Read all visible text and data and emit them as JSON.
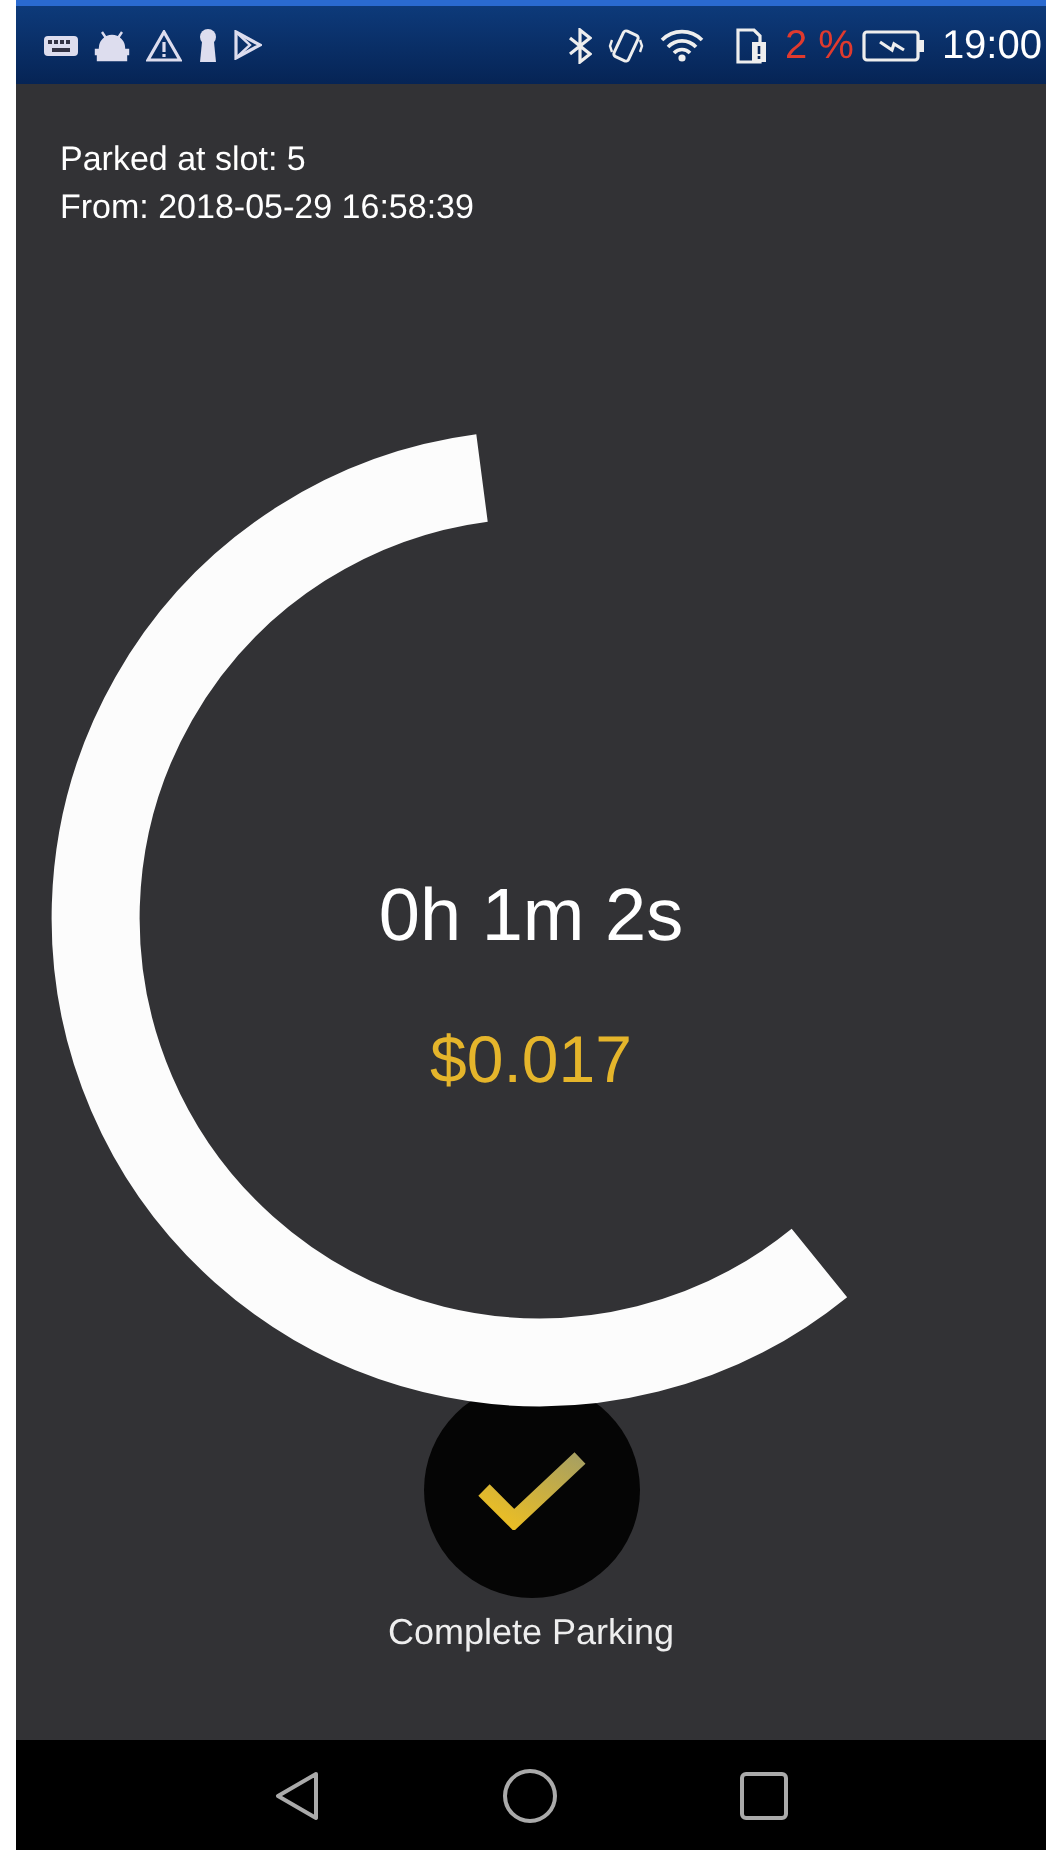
{
  "status_bar": {
    "battery_percent": "2 %",
    "time": "19:00"
  },
  "parking": {
    "slot_line": "Parked at slot: 5",
    "from_line": "From: 2018-05-29 16:58:39"
  },
  "timer": {
    "elapsed": "0h 1m 2s",
    "cost": "$0.017"
  },
  "action": {
    "label": "Complete Parking"
  }
}
